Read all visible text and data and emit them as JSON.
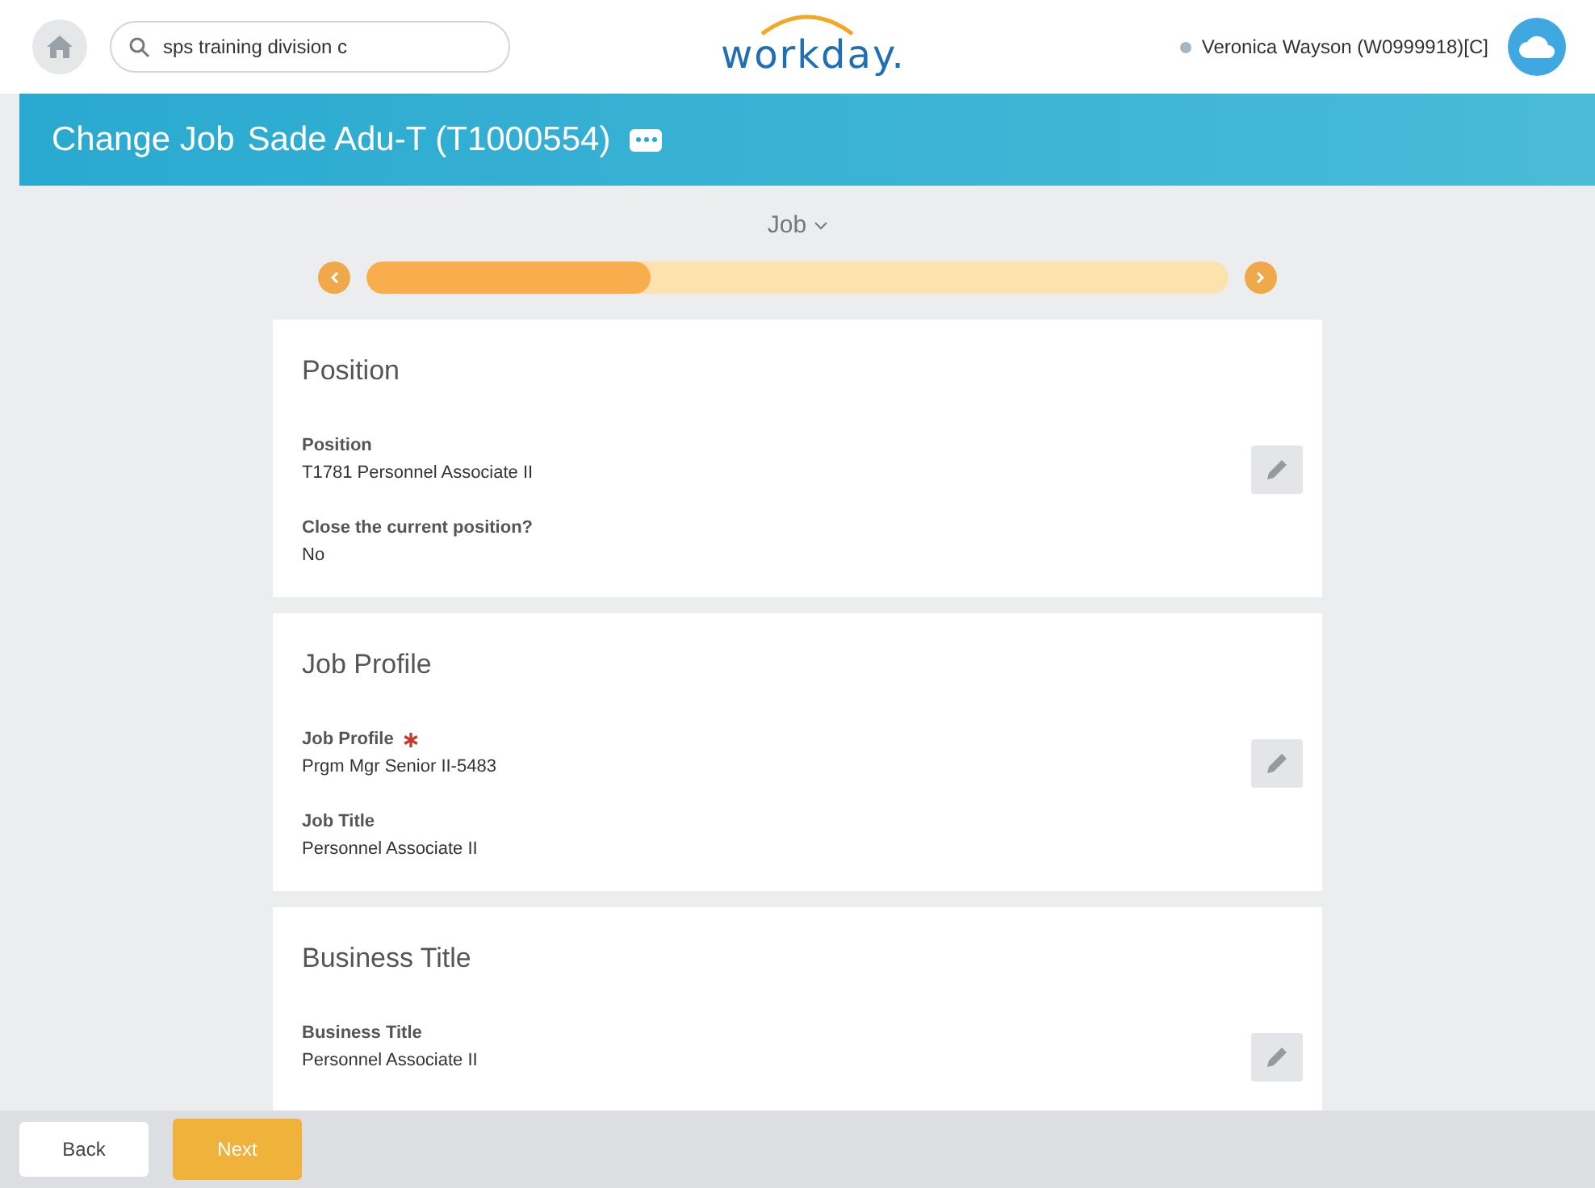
{
  "header": {
    "search": {
      "value": "sps training division c"
    },
    "logo": "workday.",
    "user": "Veronica Wayson (W0999918)[C]"
  },
  "banner": {
    "task": "Change Job",
    "worker": "Sade Adu-T (T1000554)"
  },
  "step": {
    "label": "Job",
    "level": 0.33
  },
  "sections": [
    {
      "title": "Position",
      "fields": [
        {
          "label": "Position",
          "value": "T1781 Personnel Associate II",
          "required": false
        },
        {
          "label": "Close the current position?",
          "value": "No",
          "required": false
        }
      ]
    },
    {
      "title": "Job Profile",
      "fields": [
        {
          "label": "Job Profile",
          "value": "Prgm Mgr Senior II-5483",
          "required": true
        },
        {
          "label": "Job Title",
          "value": "Personnel Associate II",
          "required": false
        }
      ]
    },
    {
      "title": "Business Title",
      "fields": [
        {
          "label": "Business Title",
          "value": "Personnel Associate II",
          "required": false
        }
      ]
    }
  ],
  "footer": {
    "buttons": [
      {
        "label": "Back",
        "kind": "secondary"
      },
      {
        "label": "Next",
        "kind": "primary"
      }
    ]
  }
}
